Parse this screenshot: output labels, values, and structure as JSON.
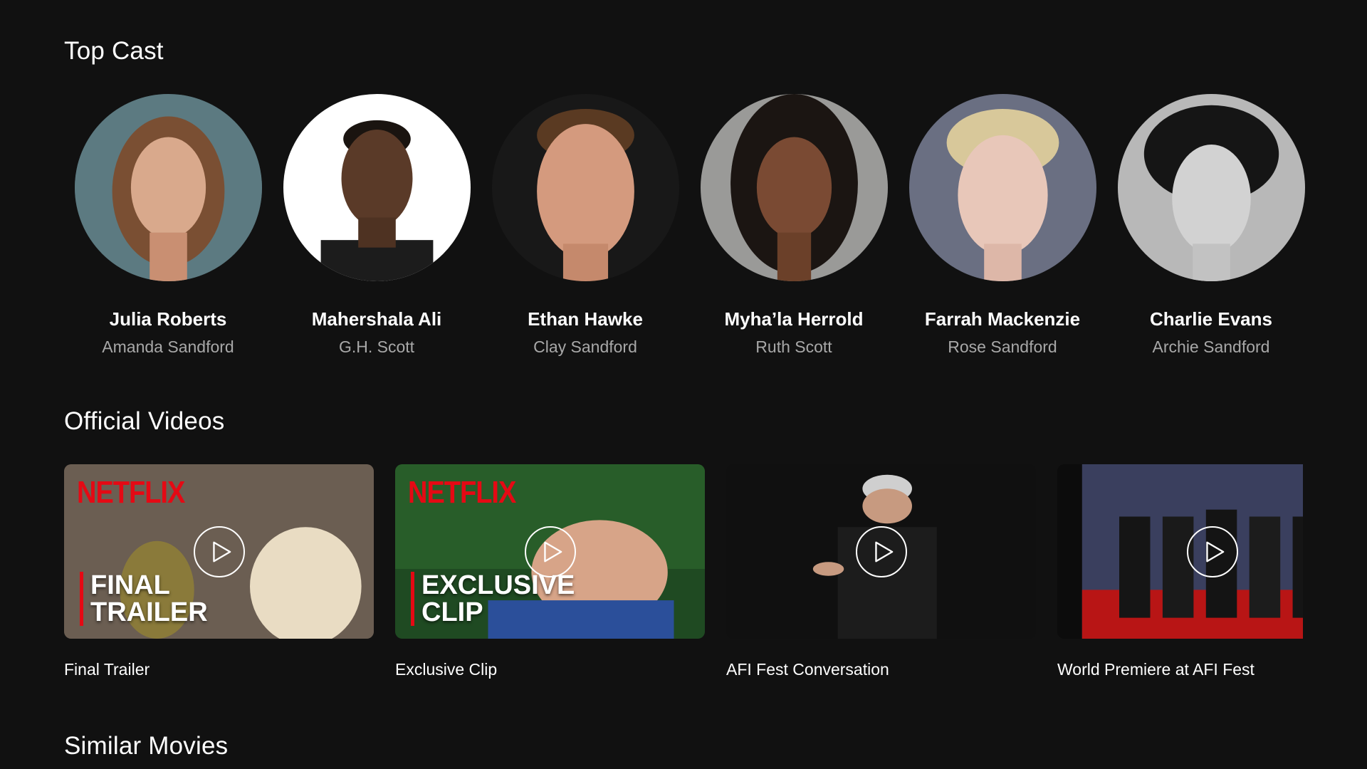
{
  "sections": {
    "cast_title": "Top Cast",
    "videos_title": "Official Videos",
    "similar_title": "Similar Movies"
  },
  "cast": [
    {
      "name": "Julia Roberts",
      "character": "Amanda Sandford"
    },
    {
      "name": "Mahershala Ali",
      "character": "G.H. Scott"
    },
    {
      "name": "Ethan Hawke",
      "character": "Clay Sandford"
    },
    {
      "name": "Myha’la Herrold",
      "character": "Ruth Scott"
    },
    {
      "name": "Farrah Mackenzie",
      "character": "Rose Sandford"
    },
    {
      "name": "Charlie Evans",
      "character": "Archie Sandford"
    }
  ],
  "videos": [
    {
      "title": "Final Trailer",
      "brand": "NETFLIX",
      "overlay": "FINAL\nTRAILER"
    },
    {
      "title": "Exclusive Clip",
      "brand": "NETFLIX",
      "overlay": "EXCLUSIVE\nCLIP"
    },
    {
      "title": "AFI Fest Conversation",
      "brand": "",
      "overlay": ""
    },
    {
      "title": "World Premiere at AFI Fest",
      "brand": "",
      "overlay": ""
    }
  ],
  "colors": {
    "background": "#111111",
    "text_primary": "#ffffff",
    "text_secondary": "#a8a8a8",
    "brand_red": "#e50914"
  },
  "icons": {
    "play": "play-circle-icon"
  }
}
